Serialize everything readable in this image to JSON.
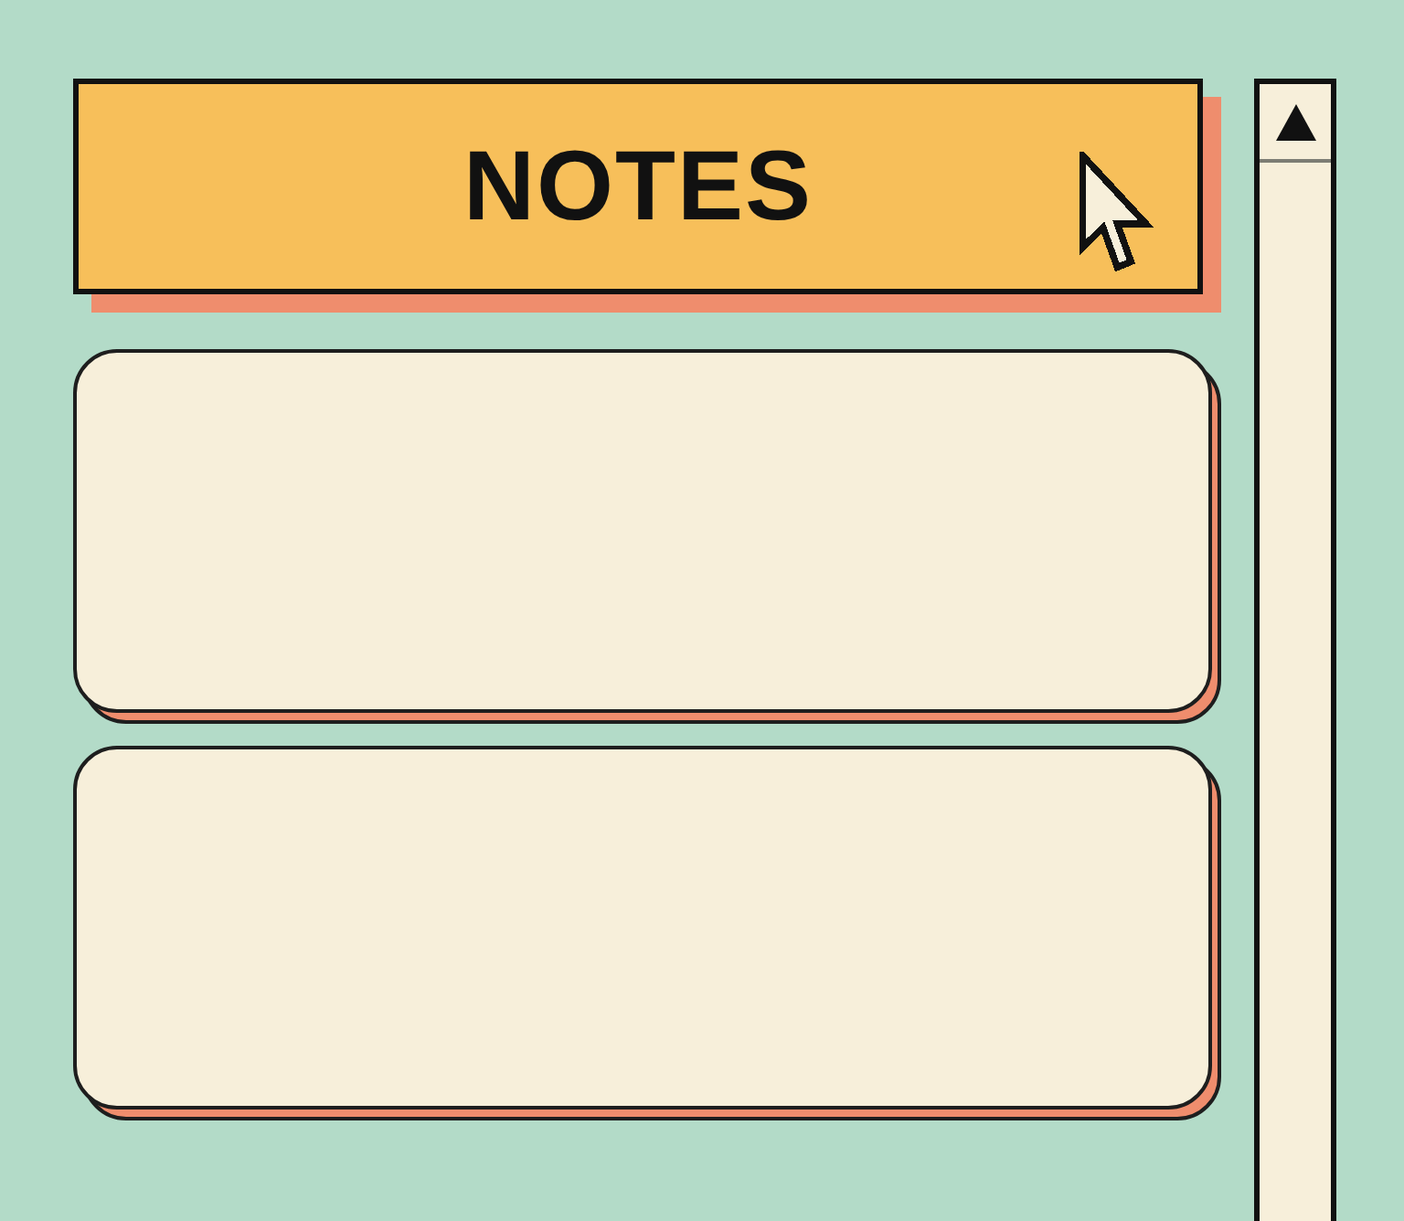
{
  "header": {
    "title": "NOTES"
  },
  "notes": [
    {
      "kind": "blank"
    },
    {
      "kind": "blank"
    }
  ]
}
